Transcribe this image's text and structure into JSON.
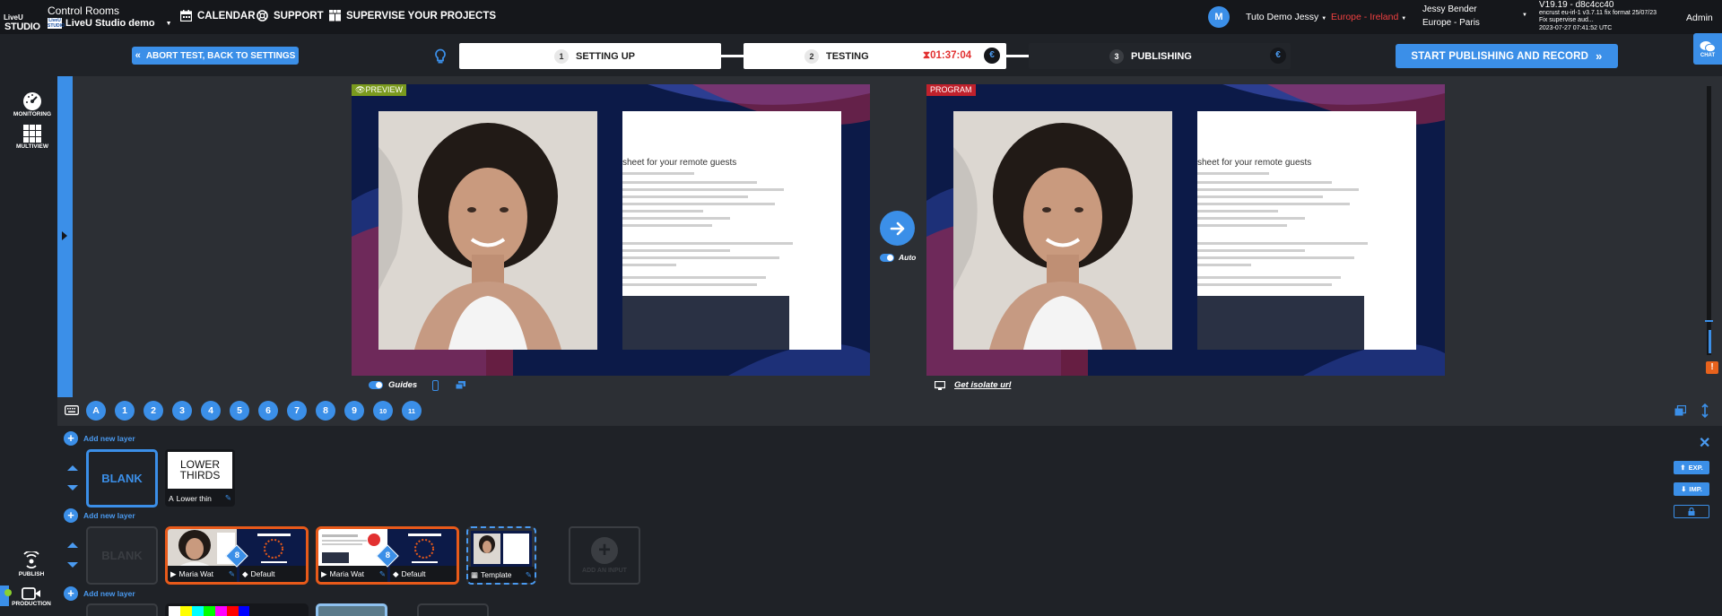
{
  "topbar": {
    "logo_top": "LiveU",
    "logo_bottom": "STUDIO",
    "room_title": "Control Rooms",
    "room_name": "LiveU Studio demo",
    "room_badge_top": "LiveU",
    "room_badge_bottom": "STUDIO",
    "nav": {
      "calendar": "CALENDAR",
      "support": "SUPPORT",
      "supervise": "SUPERVISE YOUR PROJECTS"
    },
    "avatar_initial": "M",
    "account": "Tuto Demo Jessy",
    "region": "Europe - Ireland",
    "user_name": "Jessy Bender",
    "user_location": "Europe - Paris",
    "version": "V19.19 - d8c4cc40",
    "version_line2": "encrust eu-irl-1 v3.7.11 fix format 25/07/23",
    "version_line3": "Fix supervise aud...",
    "version_line4": "2023-07-27 07:41:52 UTC",
    "role": "Admin"
  },
  "steps": {
    "abort_label": "ABORT TEST, BACK TO SETTINGS",
    "items": [
      {
        "num": "1",
        "label": "SETTING UP"
      },
      {
        "num": "2",
        "label": "TESTING"
      },
      {
        "num": "3",
        "label": "PUBLISHING"
      }
    ],
    "timer": "01:37:04",
    "currency_symbol": "€",
    "start_label": "START PUBLISHING AND RECORD",
    "chat_label": "CHAT"
  },
  "rail": {
    "monitoring": "MONITORING",
    "multiview": "MULTIVIEW",
    "publish": "PUBLISH",
    "production": "PRODUCTION"
  },
  "monitors": {
    "preview_label": "PREVIEW",
    "program_label": "PROGRAM",
    "doc_title": "sheet for your remote guests",
    "guides_label": "Guides",
    "isolate_label": "Get isolate url",
    "auto_label": "Auto"
  },
  "scenes": [
    "A",
    "1",
    "2",
    "3",
    "4",
    "5",
    "6",
    "7",
    "8",
    "9",
    "10",
    "11"
  ],
  "layers": {
    "add_label": "Add new layer",
    "blank_label": "BLANK",
    "lower_thirds_title": "LOWER THIRDS",
    "lower_thirds_name": "Lower thin",
    "input_a_name": "Maria Wat",
    "input_a_layout": "Default",
    "input_b_name": "Maria Wat",
    "input_b_layout": "Default",
    "badge_num": "8",
    "template_name": "Template",
    "add_input_label": "ADD AN INPUT"
  },
  "side_tools": {
    "exp_label": "EXP.",
    "imp_label": "IMP."
  },
  "colors": {
    "accent": "#3b8fe8",
    "live_orange": "#e85a1a",
    "timer_red": "#e23030",
    "preview_green": "#7a9a1e",
    "program_red": "#c0212c"
  }
}
